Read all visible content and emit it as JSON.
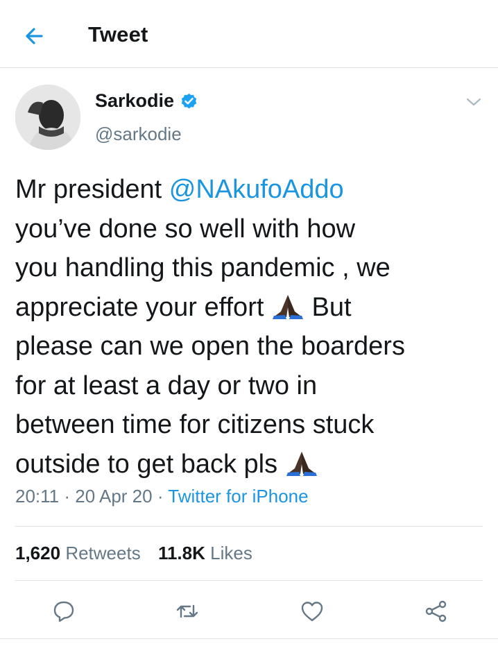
{
  "header": {
    "title": "Tweet",
    "back_icon": "arrow-left-icon"
  },
  "author": {
    "name": "Sarkodie",
    "handle": "@sarkodie",
    "verified": true
  },
  "tweet": {
    "lines": [
      {
        "before": "Mr president ",
        "mention": "@NAkufoAddo",
        "after": ""
      },
      {
        "text": "you’ve done so well with how"
      },
      {
        "text": "you handling this pandemic , we"
      },
      {
        "before": "appreciate your effort ",
        "after": " But"
      },
      {
        "text": "please can we open the boarders"
      },
      {
        "text": "for at least a day or two in"
      },
      {
        "text": "between time for citizens stuck"
      },
      {
        "before": "outside to get back pls "
      }
    ],
    "emoji": "folded-hands-icon"
  },
  "meta": {
    "time": "20:11",
    "date": "20 Apr 20",
    "separator": "·",
    "source": "Twitter for iPhone"
  },
  "stats": {
    "retweets_count": "1,620",
    "retweets_label": "Retweets",
    "likes_count": "11.8K",
    "likes_label": "Likes"
  },
  "actions": [
    "reply-icon",
    "retweet-icon",
    "like-icon",
    "share-icon"
  ],
  "colors": {
    "accent": "#1b95e0",
    "secondary_text": "#657786",
    "primary_text": "#14171a",
    "divider": "#dfe3e6"
  }
}
